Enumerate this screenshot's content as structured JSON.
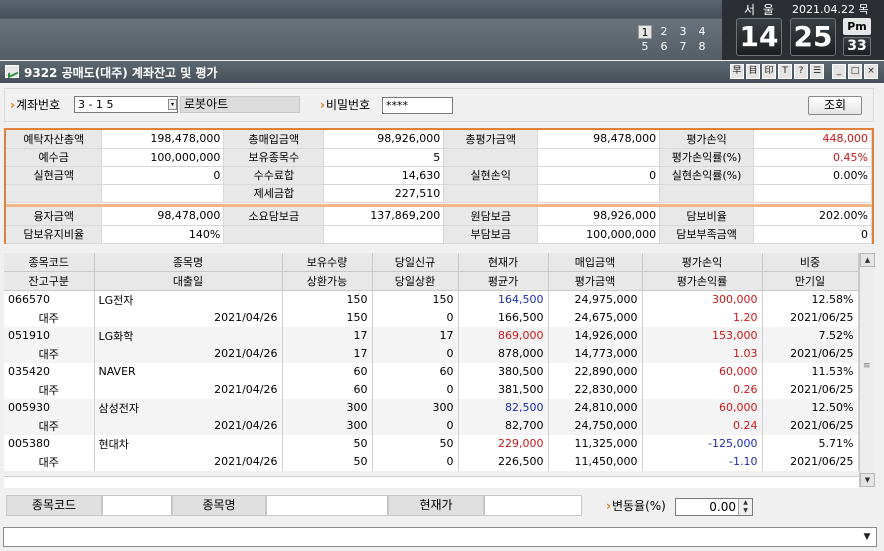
{
  "pager": {
    "pages": [
      "1",
      "2",
      "3",
      "4",
      "5",
      "6",
      "7",
      "8"
    ],
    "active": "1"
  },
  "clock": {
    "city": "서 울",
    "date": "2021.04.22 목",
    "hour": "14",
    "minute": "25",
    "ampm": "Pm",
    "seconds": "33"
  },
  "window": {
    "title": "9322 공매도(대주) 계좌잔고 및 평가",
    "buttons": [
      "早",
      "目",
      "印",
      "T",
      "?",
      "☰",
      "_",
      "□",
      "×"
    ]
  },
  "form": {
    "account_label": "계좌번호",
    "account_value": "3  -  1  5",
    "account_name": "로봇아트",
    "password_label": "비밀번호",
    "password_value": "****",
    "query_button": "조회"
  },
  "summary": {
    "rows": [
      [
        "예탁자산총액",
        "198,478,000",
        "총매입금액",
        "98,926,000",
        "총평가금액",
        "98,478,000",
        "평가손익",
        "448,000"
      ],
      [
        "예수금",
        "100,000,000",
        "보유종목수",
        "5",
        "",
        "",
        "평가손익률(%)",
        "0.45%"
      ],
      [
        "실현금액",
        "0",
        "수수료합",
        "14,630",
        "실현손익",
        "0",
        "실현손익률(%)",
        "0.00%"
      ],
      [
        "",
        "",
        "제세금합",
        "227,510",
        "",
        "",
        "",
        ""
      ]
    ],
    "rows2": [
      [
        "융자금액",
        "98,478,000",
        "소요담보금",
        "137,869,200",
        "원담보금",
        "98,926,000",
        "담보비율",
        "202.00%"
      ],
      [
        "담보유지비율",
        "140%",
        "",
        "",
        "부담보금",
        "100,000,000",
        "담보부족금액",
        "0"
      ]
    ]
  },
  "table": {
    "header1": [
      "종목코드",
      "종목명",
      "보유수량",
      "당일신규",
      "현재가",
      "매입금액",
      "평가손익",
      "비중"
    ],
    "header2": [
      "잔고구분",
      "대출일",
      "상환가능",
      "당일상환",
      "평균가",
      "평가금액",
      "평가손익률",
      "만기일"
    ],
    "rows": [
      {
        "a": [
          "066570",
          "LG전자",
          "150",
          "150",
          "164,500",
          "24,975,000",
          "300,000",
          "12.58%"
        ],
        "b": [
          "대주",
          "2021/04/26",
          "150",
          "0",
          "166,500",
          "24,675,000",
          "1.20",
          "2021/06/25"
        ],
        "price_color": "blue",
        "pl_color": "red"
      },
      {
        "a": [
          "051910",
          "LG화학",
          "17",
          "17",
          "869,000",
          "14,926,000",
          "153,000",
          "7.52%"
        ],
        "b": [
          "대주",
          "2021/04/26",
          "17",
          "0",
          "878,000",
          "14,773,000",
          "1.03",
          "2021/06/25"
        ],
        "price_color": "red",
        "pl_color": "red"
      },
      {
        "a": [
          "035420",
          "NAVER",
          "60",
          "60",
          "380,500",
          "22,890,000",
          "60,000",
          "11.53%"
        ],
        "b": [
          "대주",
          "2021/04/26",
          "60",
          "0",
          "381,500",
          "22,830,000",
          "0.26",
          "2021/06/25"
        ],
        "price_color": "black",
        "pl_color": "red"
      },
      {
        "a": [
          "005930",
          "삼성전자",
          "300",
          "300",
          "82,500",
          "24,810,000",
          "60,000",
          "12.50%"
        ],
        "b": [
          "대주",
          "2021/04/26",
          "300",
          "0",
          "82,700",
          "24,750,000",
          "0.24",
          "2021/06/25"
        ],
        "price_color": "blue",
        "pl_color": "red"
      },
      {
        "a": [
          "005380",
          "현대차",
          "50",
          "50",
          "229,000",
          "11,325,000",
          "-125,000",
          "5.71%"
        ],
        "b": [
          "대주",
          "2021/04/26",
          "50",
          "0",
          "226,500",
          "11,450,000",
          "-1.10",
          "2021/06/25"
        ],
        "price_color": "red",
        "pl_color": "blue"
      }
    ]
  },
  "search": {
    "code_label": "종목코드",
    "name_label": "종목명",
    "price_label": "현재가",
    "rate_label": "변동율(%)",
    "rate_value": "0.00"
  },
  "colors": {
    "accent": "#e07a18",
    "border": "#e0803a",
    "up": "#c81818",
    "down": "#1a2fa8"
  }
}
